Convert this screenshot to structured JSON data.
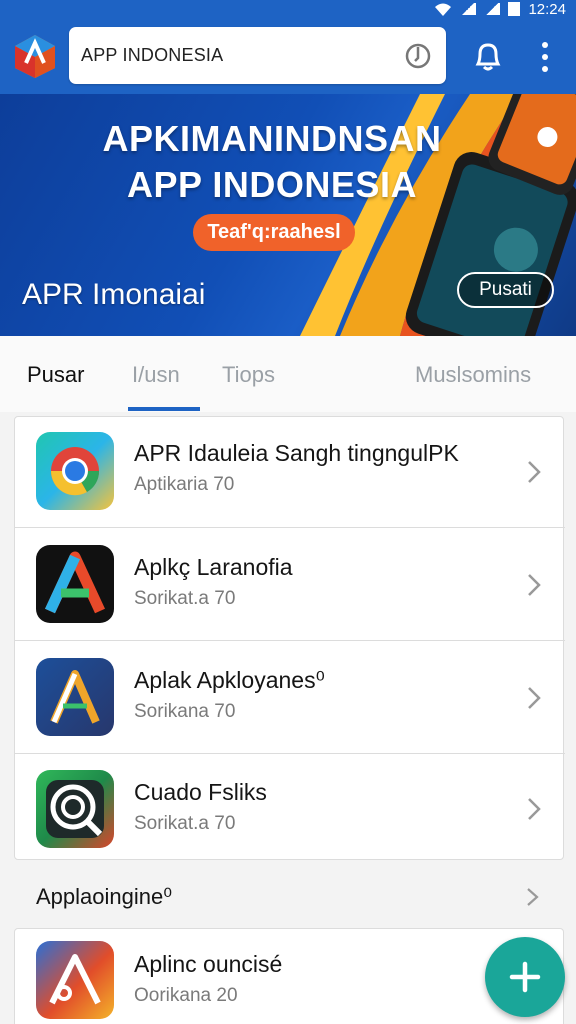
{
  "status": {
    "time": "12:24",
    "icons": [
      "wifi-icon",
      "signal-icon",
      "signal-icon",
      "battery-icon"
    ]
  },
  "header": {
    "logo": "app-logo",
    "search": {
      "value": "APP INDONESIA",
      "icon": "search-icon"
    },
    "notifications_icon": "bell-icon",
    "menu_icon": "kebab-menu-icon"
  },
  "banner": {
    "title_line1": "APKIMANINDNSAN",
    "title_line2": "APP INDONESIA",
    "pill_label": "Teaf'q:raahesl",
    "subtitle": "APR Imonaiai",
    "button_label": "Pusati"
  },
  "tabs": [
    {
      "label": "Pusar",
      "active": true
    },
    {
      "label": "I/usn",
      "active": false
    },
    {
      "label": "Tiops",
      "active": false
    },
    {
      "label": "Muslsomins",
      "active": false
    }
  ],
  "apps": [
    {
      "title": "APR Idauleia Sangh tingngulPK",
      "subtitle": "Aptikaria 70",
      "icon": "chrome-style-app-icon"
    },
    {
      "title": "Aplkç Laranofia",
      "subtitle": "Sorikat.a 70",
      "icon": "letter-a-app-icon"
    },
    {
      "title": "Aplak Apkloyanes⁰",
      "subtitle": "Sorikana 70",
      "icon": "letter-a-app-icon"
    },
    {
      "title": "Cuado Fsliks",
      "subtitle": "Sorikat.a 70",
      "icon": "lens-app-icon"
    }
  ],
  "section": {
    "title": "Applaoingine⁰"
  },
  "bottom_app": {
    "title": "Aplinc ouncisé",
    "subtitle": "Oorikana 20",
    "icon": "letter-a-app-icon"
  },
  "fab": {
    "icon": "plus-icon"
  },
  "colors": {
    "primary": "#1e63c4",
    "accent": "#f0622a",
    "fab": "#1aa699"
  }
}
